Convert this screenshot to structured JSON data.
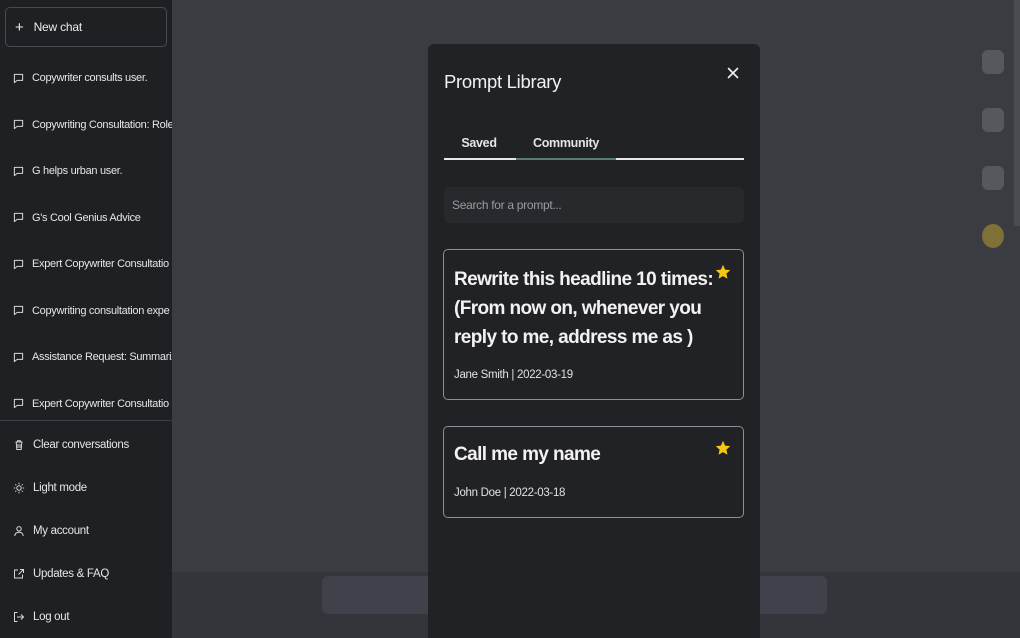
{
  "sidebar": {
    "new_chat_label": "New chat",
    "conversations": [
      {
        "label": "Copywriter consults user."
      },
      {
        "label": "Copywriting Consultation: Role"
      },
      {
        "label": "G helps urban user."
      },
      {
        "label": "G's Cool Genius Advice"
      },
      {
        "label": "Expert Copywriter Consultatio"
      },
      {
        "label": "Copywriting consultation expe"
      },
      {
        "label": "Assistance Request: Summariz"
      },
      {
        "label": "Expert Copywriter Consultatio"
      }
    ],
    "actions": [
      {
        "label": "Clear conversations",
        "icon": "trash-icon"
      },
      {
        "label": "Light mode",
        "icon": "sun-icon"
      },
      {
        "label": "My account",
        "icon": "user-icon"
      },
      {
        "label": "Updates & FAQ",
        "icon": "external-link-icon"
      },
      {
        "label": "Log out",
        "icon": "logout-icon"
      }
    ]
  },
  "modal": {
    "title": "Prompt Library",
    "close_icon": "close-icon",
    "tabs": [
      {
        "label": "Saved",
        "active": false
      },
      {
        "label": "Community",
        "active": true
      }
    ],
    "search_placeholder": "Search for a prompt...",
    "prompts": [
      {
        "title": "Rewrite this headline 10 times: (From now on, whenever you reply to me, address me as )",
        "meta": "Jane Smith | 2022-03-19",
        "starred": true
      },
      {
        "title": "Call me my name",
        "meta": "John Doe | 2022-03-18",
        "starred": true
      }
    ]
  },
  "colors": {
    "sidebar_bg": "#1f2023",
    "page_bg": "#3b3c42",
    "modal_bg": "#212225",
    "star": "#f5c518",
    "active_tab_underline": "#5a7d6e"
  }
}
